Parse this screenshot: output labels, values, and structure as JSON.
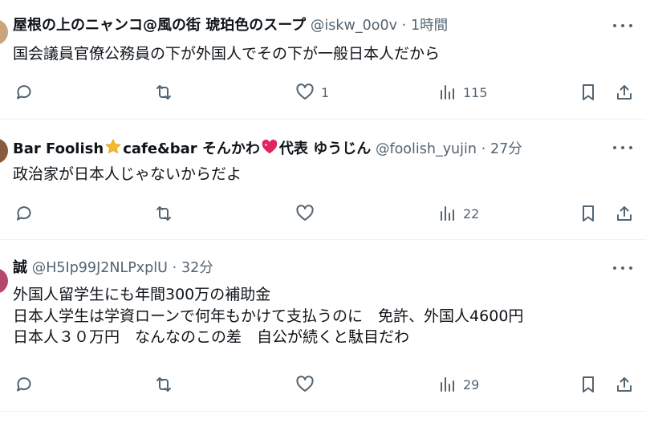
{
  "tweets": [
    {
      "display_name": "屋根の上のニャンコ@風の街 琥珀色のスープ",
      "handle": "@iskw_0o0v",
      "time": "1時間",
      "lines": [
        "国会議員官僚公務員の下が外国人でその下が一般日本人だから"
      ],
      "counts": {
        "replies": "",
        "reposts": "",
        "likes": "1",
        "views": "115"
      }
    },
    {
      "display_name_parts": [
        "Bar Foolish",
        "cafe&bar そんかわ",
        "代表 ゆうじん"
      ],
      "name_icons": [
        "star-icon",
        "sparkling-heart-icon"
      ],
      "handle": "@foolish_yujin",
      "time": "27分",
      "lines": [
        "政治家が日本人じゃないからだよ"
      ],
      "counts": {
        "replies": "",
        "reposts": "",
        "likes": "",
        "views": "22"
      }
    },
    {
      "display_name": "誠",
      "handle": "@H5Ip99J2NLPxplU",
      "time": "32分",
      "lines": [
        "外国人留学生にも年間300万の補助金",
        "日本人学生は学資ローンで何年もかけて支払うのに　免許、外国人4600円",
        "日本人３０万円　なんなのこの差　自公が続くと駄目だわ"
      ],
      "counts": {
        "replies": "",
        "reposts": "",
        "likes": "",
        "views": "29"
      }
    }
  ],
  "dot": "·",
  "icons": [
    "reply-icon",
    "repost-icon",
    "like-icon",
    "views-icon",
    "bookmark-icon",
    "share-icon",
    "more-icon"
  ],
  "colors": {
    "text": "#0f1419",
    "secondary": "#536471",
    "divider": "#eff3f4",
    "star": "#f5b82e",
    "heart": "#e0245e"
  }
}
